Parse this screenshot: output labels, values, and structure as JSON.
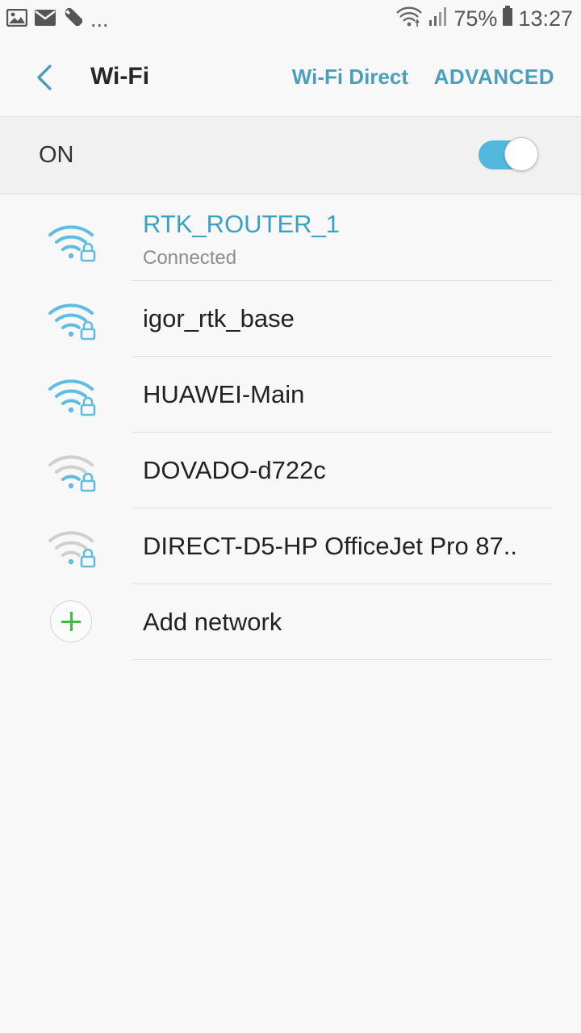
{
  "status_bar": {
    "left_icons": [
      "image-icon",
      "mail-icon",
      "wrench-icon"
    ],
    "overflow": "...",
    "battery_percent": "75%",
    "time": "13:27"
  },
  "app_bar": {
    "title": "Wi-Fi",
    "wifi_direct_label": "Wi-Fi Direct",
    "advanced_label": "ADVANCED"
  },
  "toggle": {
    "label": "ON",
    "state": true,
    "accent_color": "#53b8de"
  },
  "networks": [
    {
      "name": "RTK_ROUTER_1",
      "status": "Connected",
      "signal": "strong",
      "secured": true
    },
    {
      "name": "igor_rtk_base",
      "signal": "strong",
      "secured": true
    },
    {
      "name": "HUAWEI-Main",
      "signal": "strong",
      "secured": true
    },
    {
      "name": "DOVADO-d722c",
      "signal": "weak",
      "secured": true
    },
    {
      "name": "DIRECT-D5-HP OfficeJet Pro 87..",
      "signal": "weak",
      "secured": true
    }
  ],
  "add_network": {
    "label": "Add network",
    "icon": "plus-icon"
  },
  "colors": {
    "accent": "#4b9fbd",
    "connected": "#3aa1c4",
    "wifi_active": "#5fbde0",
    "wifi_inactive": "#c9c9c9",
    "lock": "#5fbde0"
  }
}
